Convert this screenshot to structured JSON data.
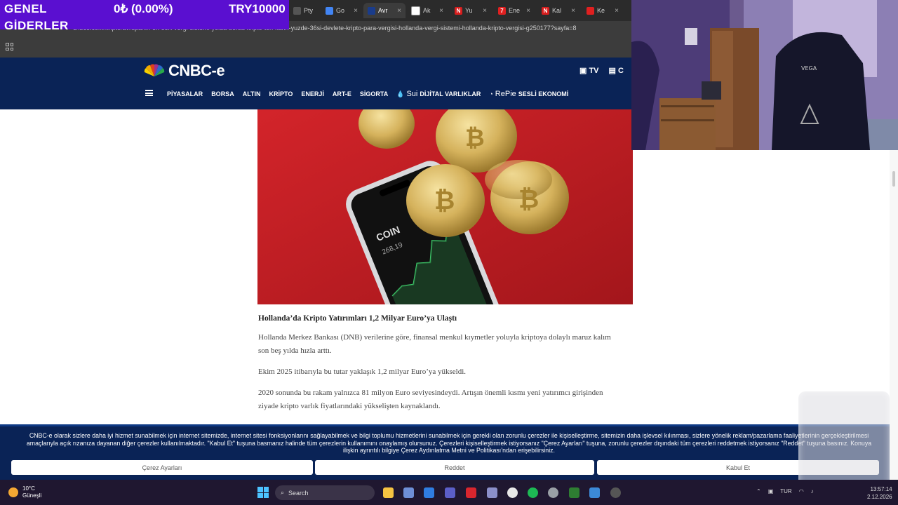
{
  "overlay": {
    "line1": "GENEL",
    "line2": "GİDERLER",
    "amount": "0₺ (0.00%)",
    "balance": "TRY10000"
  },
  "browser": {
    "tabs": [
      {
        "label": "Pty",
        "color": "#666"
      },
      {
        "label": "Go",
        "color": "#4285f4"
      },
      {
        "label": "Avr",
        "color": "#1a3c8b",
        "active": true
      },
      {
        "label": "Ak",
        "color": "#777"
      },
      {
        "label": "Yu",
        "color": "#d81e1e",
        "letter": "N"
      },
      {
        "label": "Ene",
        "color": "#e02020",
        "letter": "7"
      },
      {
        "label": "Kal",
        "color": "#d81e1e",
        "letter": "N"
      },
      {
        "label": "Ke",
        "color": "#e02020"
      }
    ],
    "url": "cnbce.com/kripto/avrupanin-en-sert-vergi-sistemi-yolda-borsa-kripto-ton-karin-yuzde-36si-devlete-kripto-para-vergisi-hollanda-vergi-sistemi-hollanda-kripto-vergisi-g250177?sayfa=8"
  },
  "site": {
    "logo": "CNBC-e",
    "header_right": [
      "TV",
      "C"
    ],
    "nav": [
      "PİYASALAR",
      "BORSA",
      "ALTIN",
      "KRİPTO",
      "ENERJİ",
      "ART-E",
      "SİGORTA"
    ],
    "sui_brand": "Sui",
    "sui_label": "DİJİTAL VARLIKLAR",
    "repie_brand": "RePie",
    "repie_label": "SESLİ EKONOMİ"
  },
  "article": {
    "heading": "Hollanda’da Kripto Yatırımları 1,2 Milyar Euro’ya Ulaştı",
    "p1": "Hollanda Merkez Bankası (DNB) verilerine göre, finansal menkul kıymetler yoluyla kriptoya dolaylı maruz kalım son beş yılda hızla arttı.",
    "p2": "Ekim 2025 itibarıyla bu tutar yaklaşık 1,2 milyar Euro’ya yükseldi.",
    "p3": "2020 sonunda bu rakam yalnızca 81 milyon Euro seviyesindeydi. Artışın önemli kısmı yeni yatırımcı girişinden ziyade kripto varlık fiyatlarındaki yükselişten kaynaklandı.",
    "phone_text": "COIN",
    "phone_value": "268,19"
  },
  "webcam": {
    "chair_text": "VEGA"
  },
  "cookie": {
    "text": "CNBC-e olarak sizlere daha iyi hizmet sunabilmek için internet sitemizde, internet sitesi fonksiyonlarını sağlayabilmek ve bilgi toplumu hizmetlerini sunabilmek için gerekli olan zorunlu çerezler ile kişiselleştirme, sitemizin daha işlevsel kılınması, sizlere yönelik reklam/pazarlama faaliyetlerinin gerçekleştirilmesi amaçlarıyla açık rızanıza dayanan diğer çerezler kullanılmaktadır. \"Kabul Et\" tuşuna basmanız halinde tüm çerezlerin kullanımını onaylamış olursunuz. Çerezleri kişiselleştirmek istiyorsanız \"Çerez Ayarları\" tuşuna, zorunlu çerezler dışındaki tüm çerezleri reddetmek istiyorsanız \"Reddet\" tuşuna basınız. Konuya ilişkin ayrıntılı bilgiye Çerez Aydınlatma Metni ve Politikası’ndan erişebilirsiniz.",
    "settings": "Çerez Ayarları",
    "reject": "Reddet",
    "accept": "Kabul Et"
  },
  "taskbar": {
    "temp": "10°C",
    "weather": "Güneşli",
    "search": "Search",
    "lang": "TUR",
    "time": "13:57:14",
    "date": "2.12.2026"
  },
  "colors": {
    "brand_navy": "#0a2356",
    "overlay_purple": "#5a0fd0",
    "hero_red": "#c81d22"
  }
}
